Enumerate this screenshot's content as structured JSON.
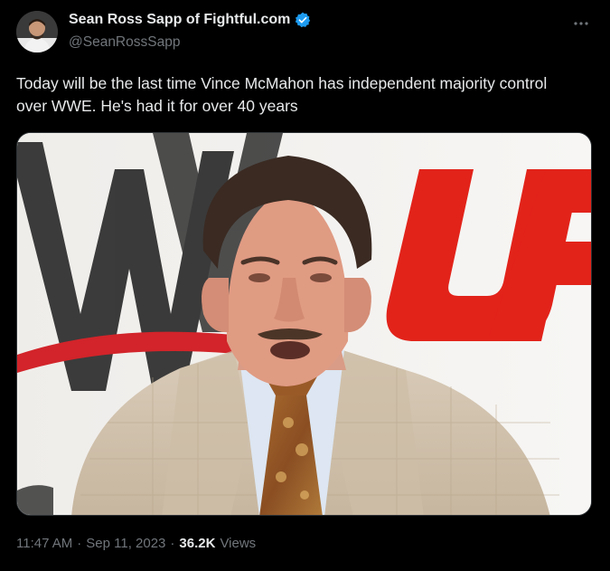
{
  "author": {
    "display_name": "Sean Ross Sapp of Fightful.com",
    "handle": "@SeanRossSapp",
    "verified_color": "#1d9bf0"
  },
  "tweet": {
    "text": "Today will be the last time Vince McMahon has independent majority control over WWE. He's had it for over 40 years",
    "time": "11:47 AM",
    "separator": "·",
    "date": "Sep 11, 2023",
    "views_count": "36.2K",
    "views_label": "Views"
  },
  "media": {
    "wwe_logo_color": "#2b2b2b",
    "ufc_logo_color": "#e2231a",
    "ufc_letters": "UF"
  },
  "icons": {
    "more": "more-icon",
    "verified": "verified-badge-icon"
  }
}
